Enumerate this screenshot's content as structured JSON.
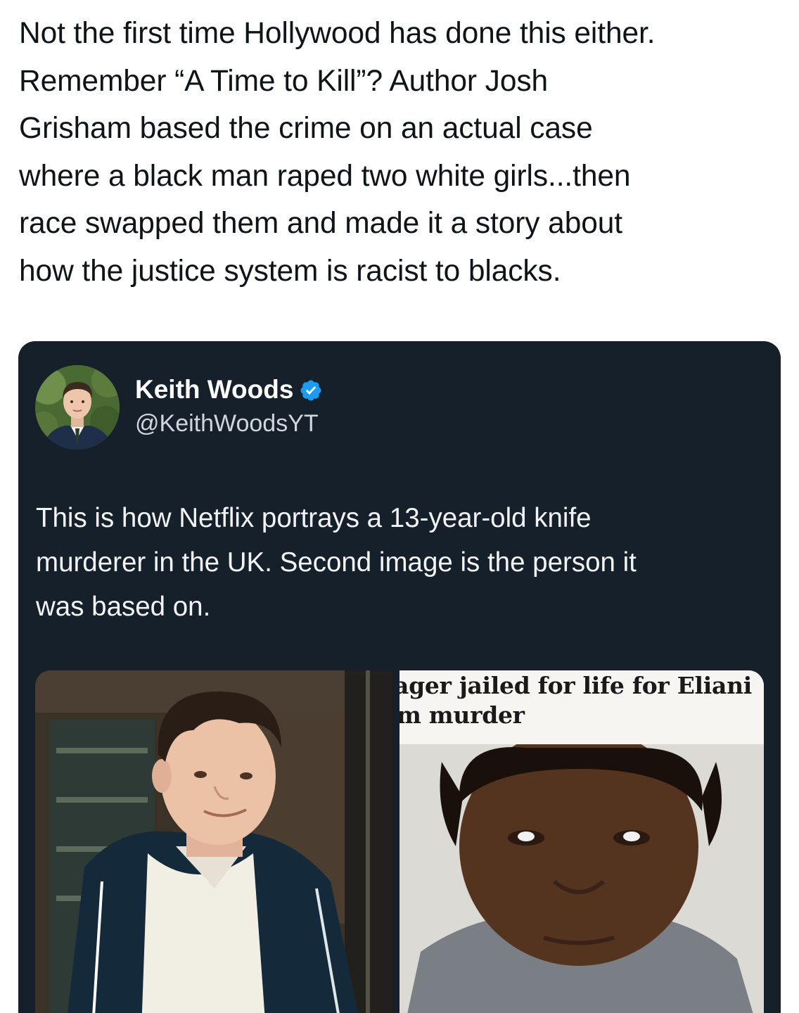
{
  "post": {
    "lines": [
      "Not the first time Hollywood has done this either.",
      "Remember “A Time to Kill”? Author Josh",
      "Grisham based the crime on an actual case",
      "where a black man raped two white girls...then",
      "race swapped them and made it a story about",
      "how the justice system is racist to blacks."
    ]
  },
  "quoted_tweet": {
    "author_name": "Keith Woods",
    "author_handle": "@KeithWoodsYT",
    "verified_icon": "verified-badge-icon",
    "text_lines": [
      "This is how Netflix portrays a 13-year-old knife",
      "murderer in the UK. Second image is the person it",
      "was based on."
    ],
    "media": {
      "right_headline_lines": [
        "ager jailed for life for Eliani",
        "m murder"
      ]
    }
  },
  "colors": {
    "card_background": "#15202b",
    "verified_blue": "#1d9bf0",
    "text_dark": "#0f1419"
  }
}
